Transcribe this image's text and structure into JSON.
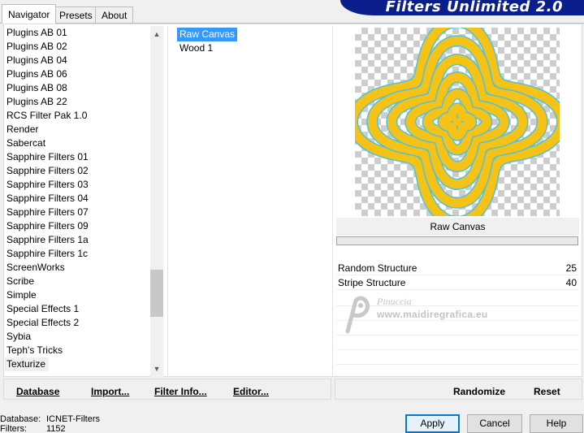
{
  "window": {
    "banner_title": "Filters Unlimited 2.0"
  },
  "tabs": [
    {
      "label": "Navigator",
      "active": true
    },
    {
      "label": "Presets",
      "active": false
    },
    {
      "label": "About",
      "active": false
    }
  ],
  "categories": {
    "items": [
      "Plugins AB 01",
      "Plugins AB 02",
      "Plugins AB 04",
      "Plugins AB 06",
      "Plugins AB 08",
      "Plugins AB 22",
      "RCS Filter Pak 1.0",
      "Render",
      "Sabercat",
      "Sapphire Filters 01",
      "Sapphire Filters 02",
      "Sapphire Filters 03",
      "Sapphire Filters 04",
      "Sapphire Filters 07",
      "Sapphire Filters 09",
      "Sapphire Filters 1a",
      "Sapphire Filters 1c",
      "ScreenWorks",
      "Scribe",
      "Simple",
      "Special Effects 1",
      "Special Effects 2",
      "Sybia",
      "Teph's Tricks",
      "Texturize"
    ],
    "selected": "Texturize"
  },
  "filters": {
    "items": [
      "Raw Canvas",
      "Wood 1"
    ],
    "selected": "Raw Canvas"
  },
  "preview": {
    "filter_name": "Raw Canvas",
    "colors": {
      "stripe": "#f5c218",
      "outline": "#4fc3d9"
    }
  },
  "parameters": [
    {
      "label": "Random Structure",
      "value": "25"
    },
    {
      "label": "Stripe Structure",
      "value": "40"
    }
  ],
  "watermark": {
    "line1": "Pinuccia",
    "line2": "www.maidiregrafica.eu"
  },
  "left_buttons": {
    "database": "Database",
    "import": "Import...",
    "filter_info": "Filter Info...",
    "editor": "Editor..."
  },
  "right_buttons": {
    "randomize": "Randomize",
    "reset": "Reset"
  },
  "status": {
    "database_label": "Database:",
    "database_value": "ICNET-Filters",
    "filters_label": "Filters:",
    "filters_value": "1152"
  },
  "dialog_buttons": {
    "apply": "Apply",
    "cancel": "Cancel",
    "help": "Help"
  }
}
